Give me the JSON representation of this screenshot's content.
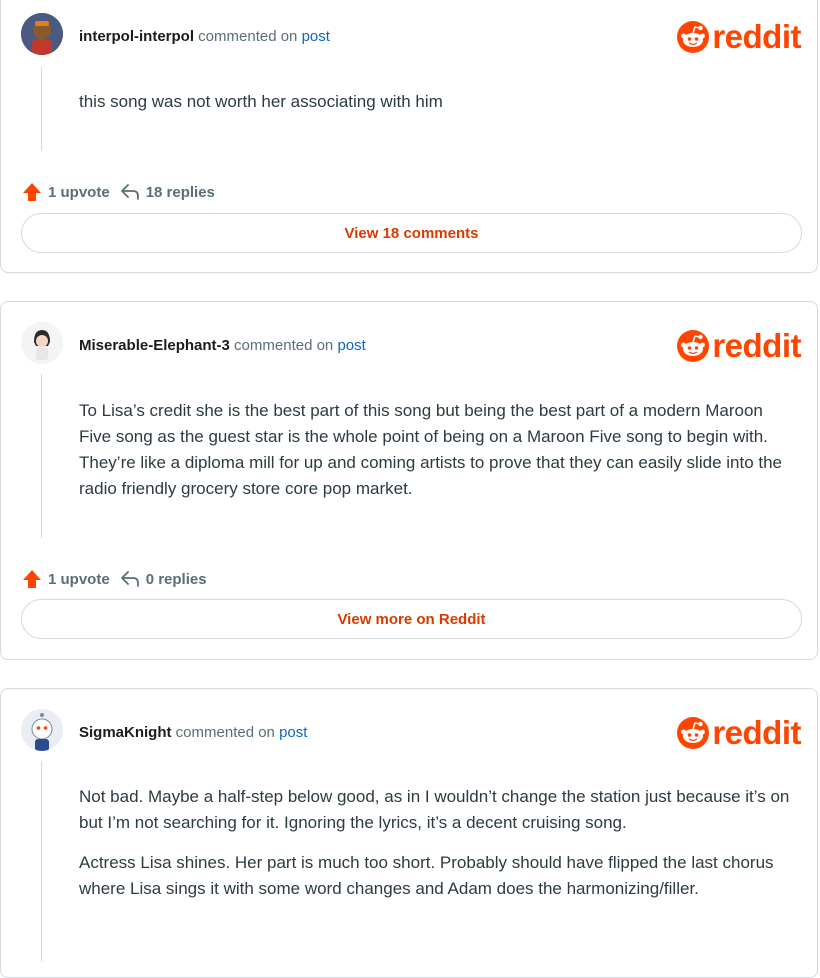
{
  "brand": {
    "name": "reddit",
    "color": "#ff4500"
  },
  "comments": [
    {
      "username": "interpol-interpol",
      "commented": "commented on",
      "post_link": "post",
      "body": [
        "this song was not worth her associating with him"
      ],
      "upvotes": "1 upvote",
      "replies": "18 replies",
      "button": "View 18 comments"
    },
    {
      "username": "Miserable-Elephant-3",
      "commented": "commented on",
      "post_link": "post",
      "body": [
        "To Lisa’s credit she is the best part of this song but being the best part of a modern Maroon Five song as the guest star is the whole point of being on a Maroon Five song to begin with. They’re like a diploma mill for up and coming artists to prove that they can easily slide into the radio friendly grocery store core pop market."
      ],
      "upvotes": "1 upvote",
      "replies": "0 replies",
      "button": "View more on Reddit"
    },
    {
      "username": "SigmaKnight",
      "commented": "commented on",
      "post_link": "post",
      "body": [
        "Not bad. Maybe a half-step below good, as in I wouldn’t change the station just because it’s on but I’m not searching for it. Ignoring the lyrics, it’s a decent cruising song.",
        "Actress Lisa shines. Her part is much too short. Probably should have flipped the last chorus where Lisa sings it with some word changes and Adam does the harmonizing/filler."
      ]
    }
  ],
  "icons": {
    "upvote": "upvote-arrow-icon",
    "reply": "reply-arrow-icon",
    "logo": "reddit-snoo-icon"
  }
}
